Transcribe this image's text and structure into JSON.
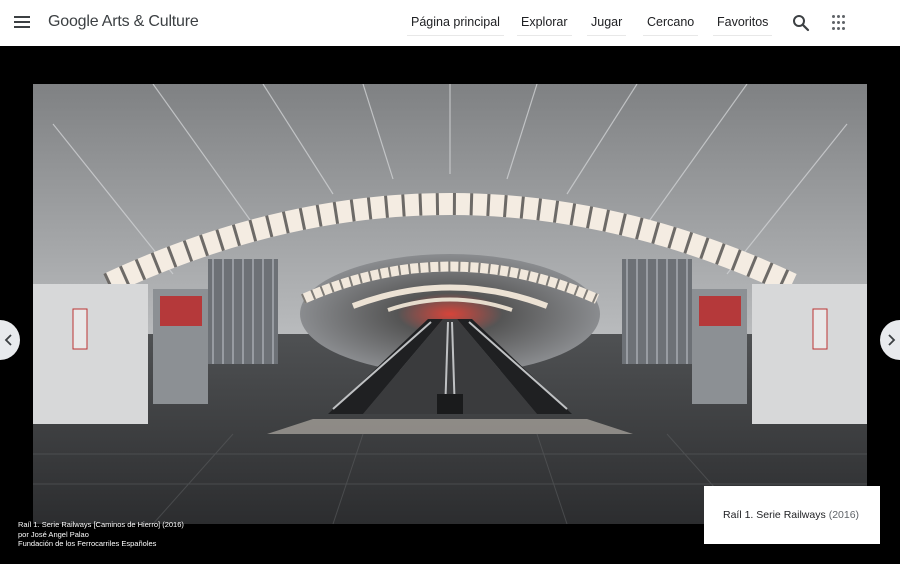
{
  "header": {
    "logo_google": "Google",
    "logo_suffix": "Arts & Culture",
    "nav": [
      {
        "label": "Página principal"
      },
      {
        "label": "Explorar"
      },
      {
        "label": "Jugar"
      },
      {
        "label": "Cercano"
      },
      {
        "label": "Favoritos"
      }
    ]
  },
  "credit": {
    "line1": "Raíl 1. Serie Railways [Caminos de Hierro] (2016)",
    "line2": "por José Angel Palao",
    "line3": "Fundación de los Ferrocarriles Españoles"
  },
  "caption": {
    "title": "Raíl 1. Serie Railways",
    "year": "(2016)"
  },
  "icons": {
    "menu": "hamburger-menu-icon",
    "search": "search-icon",
    "apps": "apps-grid-icon",
    "prev": "chevron-left-icon",
    "next": "chevron-right-icon"
  },
  "colors": {
    "header_bg": "#ffffff",
    "stage_bg": "#000000",
    "arrow_bg": "#e8eaed"
  }
}
